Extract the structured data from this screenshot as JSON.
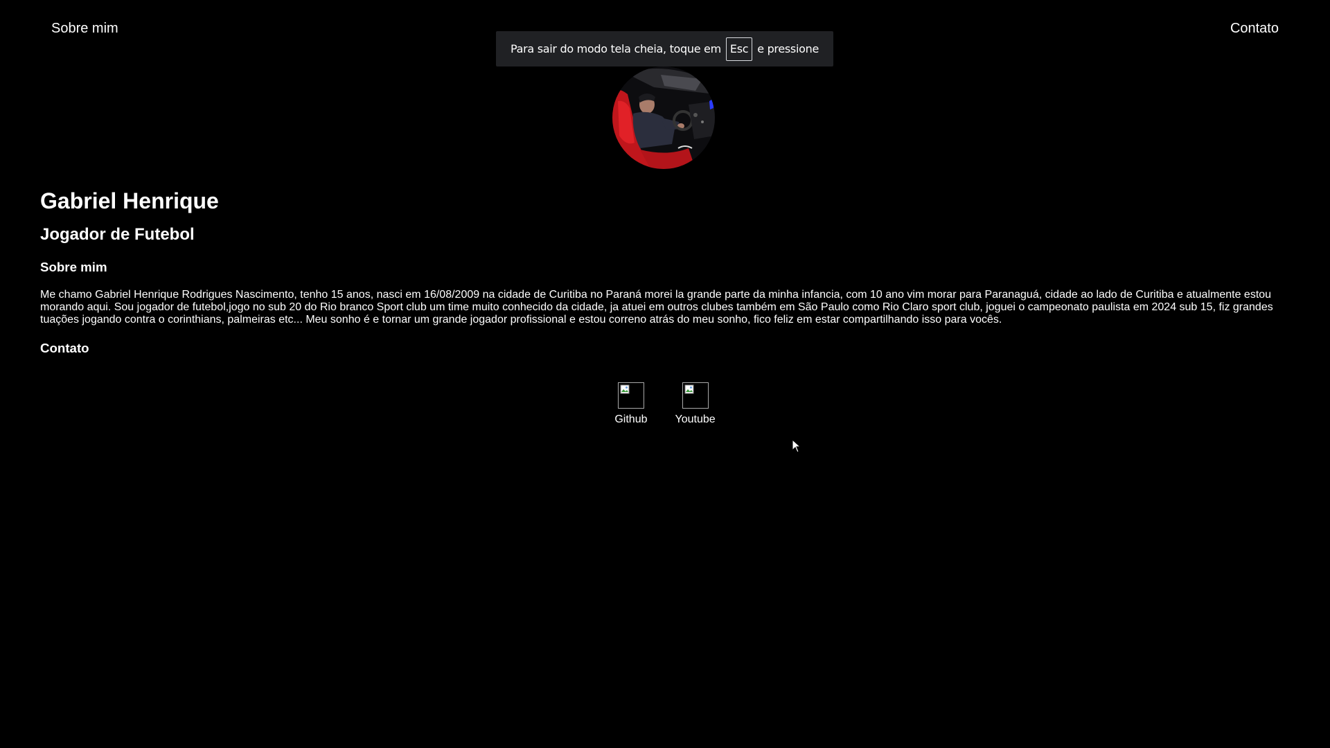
{
  "nav": {
    "left_label": "Sobre mim",
    "right_label": "Contato"
  },
  "fullscreen_toast": {
    "text_before": "Para sair do modo tela cheia, toque em",
    "key": "Esc",
    "text_after": "e pressione"
  },
  "profile": {
    "name": "Gabriel Henrique",
    "role": "Jogador de Futebol"
  },
  "about": {
    "heading": "Sobre mim",
    "text": "Me chamo Gabriel Henrique Rodrigues Nascimento, tenho 15 anos, nasci em 16/08/2009 na cidade de Curitiba no Paraná morei la grande parte da minha infancia, com 10 ano vim morar para Paranaguá, cidade ao lado de Curitiba e atualmente estou morando aqui. Sou jogador de futebol,jogo no sub 20 do Rio branco Sport club um time muito conhecido da cidade, ja atuei em outros clubes também em São Paulo como Rio Claro sport club, joguei o campeonato paulista em 2024 sub 15, fiz grandes tuações jogando contra o corinthians, palmeiras etc... Meu sonho é e tornar um grande jogador profissional e estou correno atrás do meu sonho, fico feliz em estar compartilhando isso para vocês."
  },
  "contact": {
    "heading": "Contato",
    "links": [
      {
        "label": "Github",
        "icon": "broken-image-icon"
      },
      {
        "label": "Youtube",
        "icon": "broken-image-icon"
      }
    ]
  },
  "colors": {
    "background": "#000000",
    "text": "#ffffff",
    "toast_background": "#202124"
  }
}
